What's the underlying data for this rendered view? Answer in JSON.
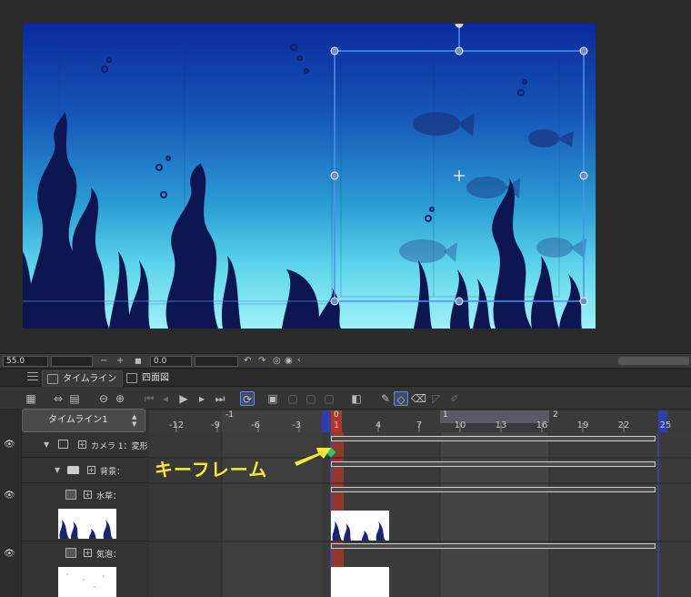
{
  "status": {
    "zoom_value": "55.0",
    "rotate_value": "0.0",
    "zoom_out_glyph": "−",
    "zoom_in_glyph": "+",
    "fit_glyph": "■"
  },
  "tabs": [
    {
      "label": "タイムライン",
      "active": true,
      "icon": "timeline-tab-icon"
    },
    {
      "label": "四面図",
      "active": false,
      "icon": "four-view-tab-icon"
    }
  ],
  "timeline": {
    "selector_label": "タイムライン1",
    "ruler_ticks": [
      "-12",
      "-9",
      "-6",
      "-3",
      "1",
      "4",
      "7",
      "10",
      "13",
      "16",
      "19",
      "22",
      "25"
    ],
    "ruler_sections": [
      "-1",
      "1",
      "1",
      "2"
    ],
    "current_frame_label": "0"
  },
  "layers": [
    {
      "name": "カメラ 1：変形",
      "type": "camera"
    },
    {
      "name": "背景：",
      "type": "folder"
    },
    {
      "name": "水草：",
      "type": "raster"
    },
    {
      "name": "気泡：",
      "type": "raster"
    }
  ],
  "annotation": {
    "callout_text": "キーフレーム"
  },
  "colors": {
    "accent": "#f6e83b",
    "playhead": "#c0392b",
    "selection": "#5b9bff",
    "keyframe": "#3fbf6a"
  }
}
